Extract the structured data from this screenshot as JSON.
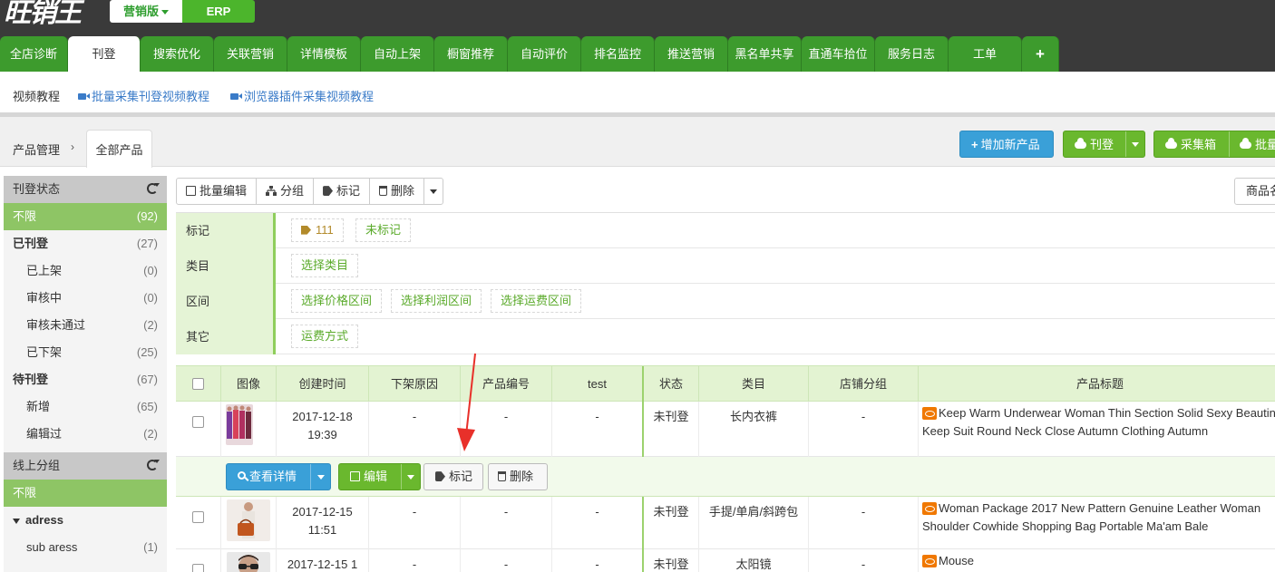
{
  "header": {
    "logo_text": "旺销王",
    "version_active": "营销版",
    "version_other": "ERP"
  },
  "tabs": [
    {
      "label": "全店诊断"
    },
    {
      "label": "刊登"
    },
    {
      "label": "搜索优化"
    },
    {
      "label": "关联营销"
    },
    {
      "label": "详情模板"
    },
    {
      "label": "自动上架"
    },
    {
      "label": "橱窗推荐"
    },
    {
      "label": "自动评价"
    },
    {
      "label": "排名监控"
    },
    {
      "label": "推送营销"
    },
    {
      "label": "黑名单共享"
    },
    {
      "label": "直通车拾位"
    },
    {
      "label": "服务日志"
    },
    {
      "label": "工单"
    },
    {
      "label": "+"
    }
  ],
  "subnav": {
    "title": "视频教程",
    "link1": "批量采集刊登视频教程",
    "link2": "浏览器插件采集视频教程"
  },
  "breadcrumb": {
    "parent": "产品管理",
    "arrow": "›",
    "current": "全部产品"
  },
  "top_buttons": {
    "add_product": "增加新产品",
    "publish": "刊登",
    "collect_box": "采集箱",
    "batch": "批量"
  },
  "sidebar": {
    "status_header": "刊登状态",
    "status_items": [
      {
        "label": "不限",
        "count": "(92)"
      },
      {
        "label": "已刊登",
        "count": "(27)"
      },
      {
        "label": "已上架",
        "count": "(0)"
      },
      {
        "label": "审核中",
        "count": "(0)"
      },
      {
        "label": "审核未通过",
        "count": "(2)"
      },
      {
        "label": "已下架",
        "count": "(25)"
      },
      {
        "label": "待刊登",
        "count": "(67)"
      },
      {
        "label": "新增",
        "count": "(65)"
      },
      {
        "label": "编辑过",
        "count": "(2)"
      }
    ],
    "group_header": "线上分组",
    "group_items": [
      {
        "label": "不限"
      },
      {
        "label": "adress"
      },
      {
        "label": "sub aress",
        "count": "(1)"
      }
    ]
  },
  "toolbar": {
    "batch_edit": "批量编辑",
    "group": "分组",
    "mark": "标记",
    "delete": "删除",
    "sort": "商品名"
  },
  "filters": {
    "mark_label": "标记",
    "mark_tag": "111",
    "mark_untagged": "未标记",
    "category_label": "类目",
    "category_select": "选择类目",
    "range_label": "区间",
    "price_range": "选择价格区间",
    "profit_range": "选择利润区间",
    "shipping_range": "选择运费区间",
    "other_label": "其它",
    "shipping_method": "运费方式"
  },
  "table": {
    "headers": [
      "图像",
      "创建时间",
      "下架原因",
      "产品编号",
      "test",
      "状态",
      "类目",
      "店铺分组",
      "产品标题"
    ],
    "rows": [
      {
        "created": "2017-12-18 19:39",
        "reason": "-",
        "code": "-",
        "test": "-",
        "status": "未刊登",
        "category": "长内衣裤",
        "group": "-",
        "title": "Keep Warm Underwear Woman Thin Section Solid Sexy Beauting Keep Suit Round Neck Close Autumn Clothing Autumn"
      },
      {
        "created": "2017-12-15 11:51",
        "reason": "-",
        "code": "-",
        "test": "-",
        "status": "未刊登",
        "category": "手提/单肩/斜跨包",
        "group": "-",
        "title": "Woman Package 2017 New Pattern Genuine Leather Woman Shoulder Cowhide Shopping Bag Portable Ma'am Bale"
      },
      {
        "created": "2017-12-15 1",
        "reason": "-",
        "code": "-",
        "test": "-",
        "status": "未刊登",
        "category": "太阳镜",
        "group": "-",
        "title": "Mouse"
      }
    ],
    "actions": {
      "view_detail": "查看详情",
      "edit": "编辑",
      "mark": "标记",
      "delete": "删除"
    }
  },
  "colors": {
    "tab_green": "#3d9b2d",
    "accent_green": "#6ab82e",
    "accent_blue": "#3aa0d8",
    "annotation_red": "#e8302a"
  }
}
